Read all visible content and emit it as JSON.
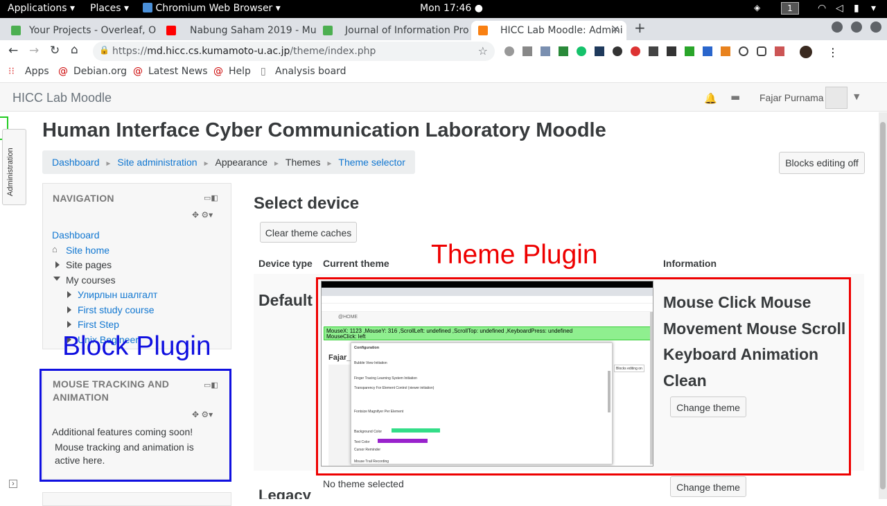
{
  "system_bar": {
    "applications": "Applications",
    "places": "Places",
    "app": "Chromium Web Browser",
    "clock": "Mon 17:46",
    "workspace": "1"
  },
  "tabs": [
    {
      "title": "Your Projects - Overleaf, O",
      "color": "#4caf50"
    },
    {
      "title": "Nabung Saham 2019 - Mu",
      "color": "#ff0000"
    },
    {
      "title": "Journal of Information Pro",
      "color": "#4caf50"
    },
    {
      "title": "HICC Lab Moodle: Admini",
      "color": "#f98012"
    }
  ],
  "address": {
    "scheme": "https://",
    "host": "md.hicc.cs.kumamoto-u.ac.jp",
    "path": "/theme/index.php"
  },
  "bookmarks": [
    "Apps",
    "Debian.org",
    "Latest News",
    "Help",
    "Analysis board"
  ],
  "moodle": {
    "site_name": "HICC Lab Moodle",
    "user_name": "Fajar Purnama",
    "drawer_tab": "Administration",
    "page_title": "Human Interface Cyber Communication Laboratory Moodle",
    "breadcrumb": [
      "Dashboard",
      "Site administration",
      "Appearance",
      "Themes",
      "Theme selector"
    ],
    "blocks_editing": "Blocks editing off",
    "navigation": {
      "title": "NAVIGATION",
      "items": [
        "Dashboard",
        "Site home",
        "Site pages",
        "My courses",
        "Улирлын шалгалт",
        "First study course",
        "First Step",
        "Unix Begineer"
      ]
    },
    "mouse_block": {
      "title": "MOUSE TRACKING AND ANIMATION",
      "line1": "Additional features coming soon!",
      "line2": "Mouse tracking and animation is active here."
    },
    "select_device": "Select device",
    "clear_caches": "Clear theme caches",
    "table_headers": [
      "Device type",
      "Current theme",
      "Information"
    ],
    "default_device": "Default",
    "theme_info": "Mouse Click Mouse Movement Mouse Scroll Keyboard Animation Clean",
    "change_theme": "Change theme",
    "no_theme": "No theme selected",
    "legacy": "Legacy"
  },
  "annotations": {
    "theme_plugin": "Theme Plugin",
    "block_plugin": "Block Plugin"
  },
  "inner_screenshot": {
    "tracking_line": "MouseX: 1123 ,MouseY: 316 ,ScrollLeft: undefined ,ScrollTop: undefined ,KeyboardPress: undefined",
    "click_line": "MouseClick: left",
    "home": "@HOME",
    "config_title": "Configuration",
    "config_items": [
      "Bubble View Initiation",
      "Finger Tracing Learning System Initiation",
      "Transparency For Element Control (viewer initiation)",
      "Fontsize Magnifyer Per Element",
      "Background Color",
      "Text Color",
      "Cursor Reminder",
      "Mouse Trail Recording"
    ],
    "blocks_btn": "Blocks editing on"
  }
}
